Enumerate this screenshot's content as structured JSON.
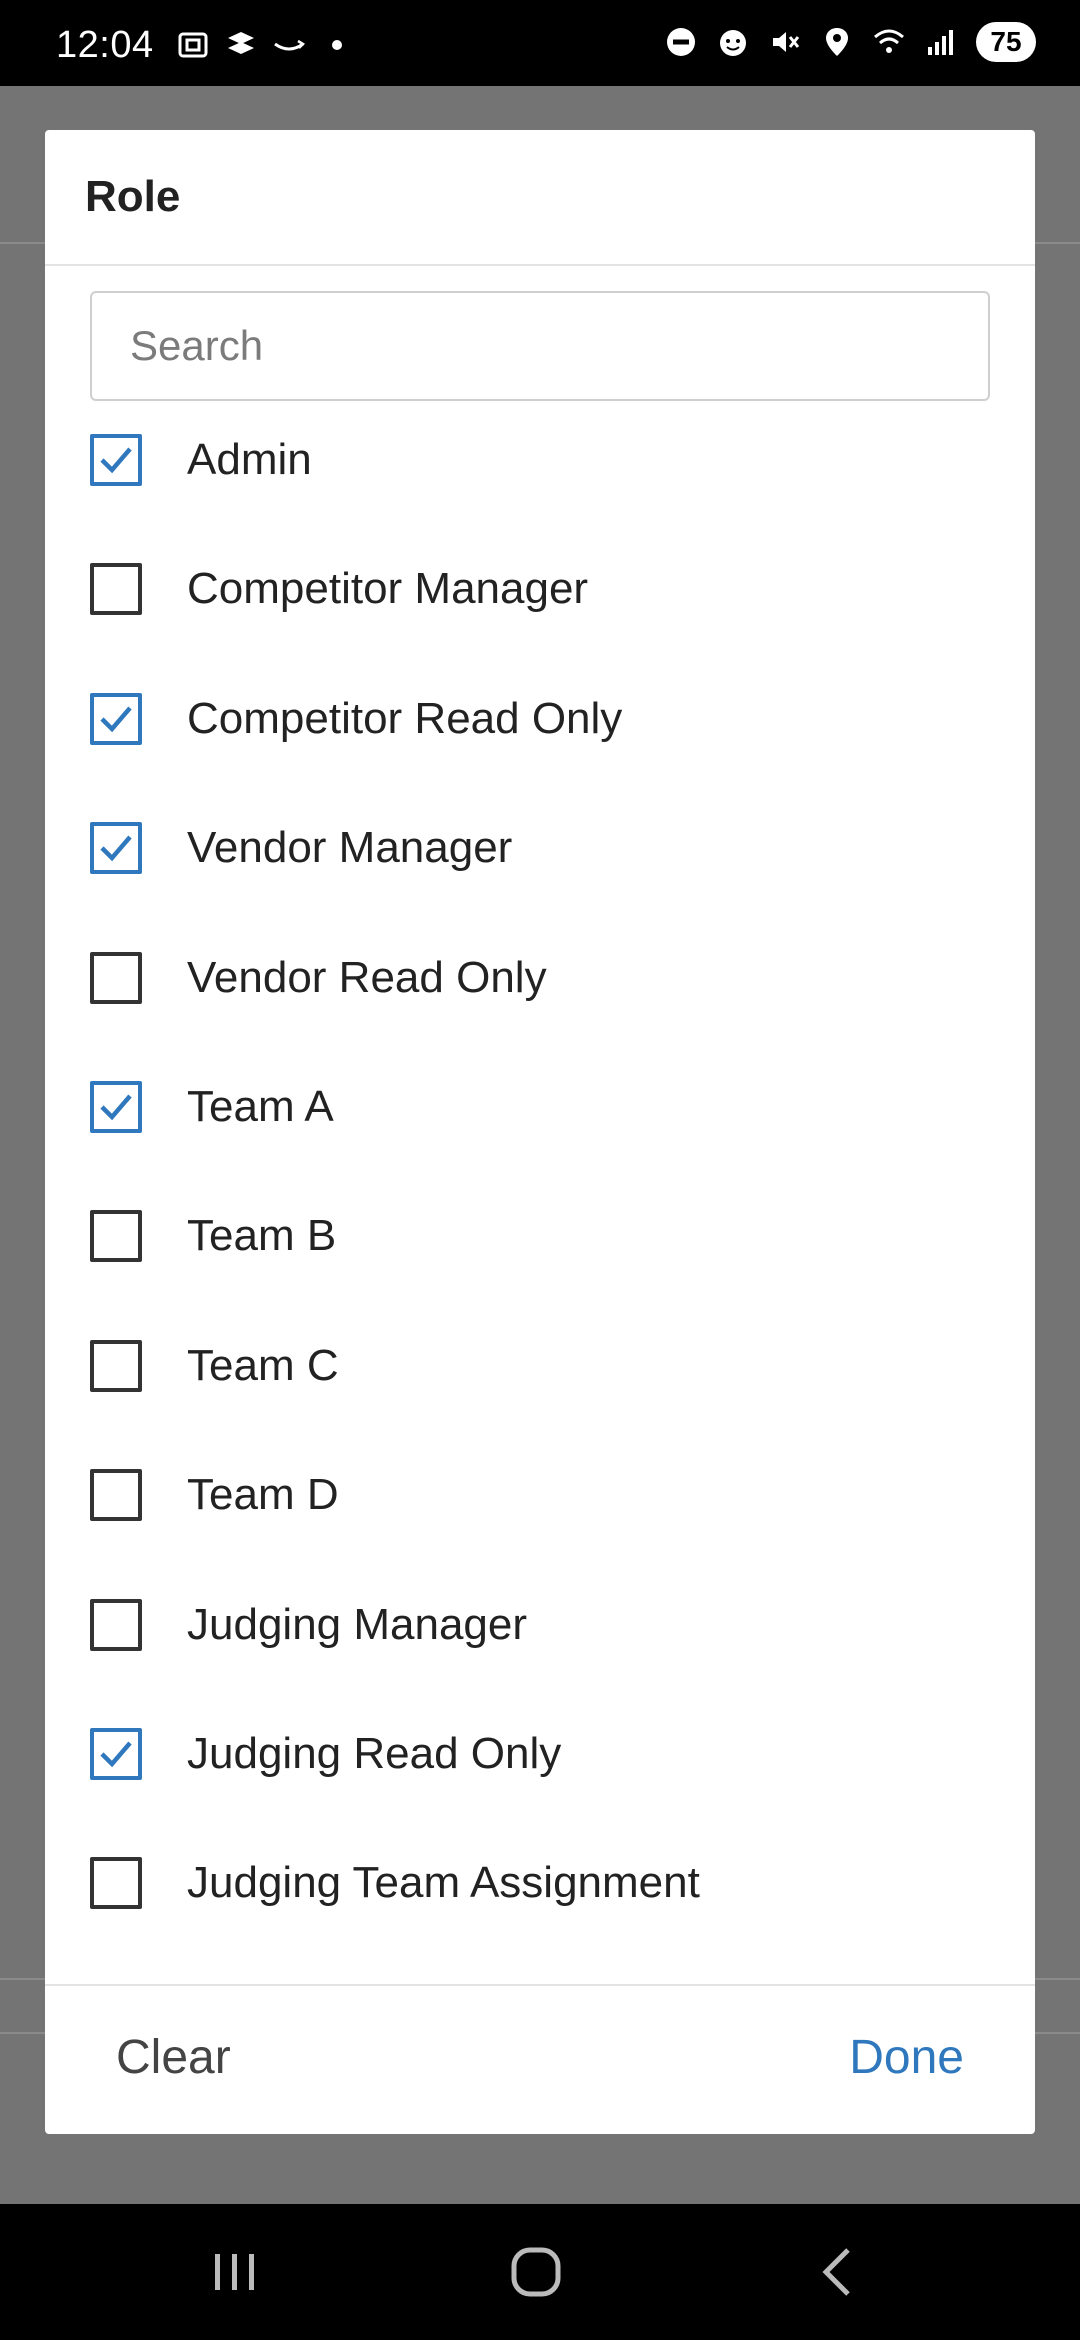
{
  "status_bar": {
    "time": "12:04",
    "battery": "75",
    "left_icons": [
      "screenshot-icon",
      "dropbox-icon",
      "amazon-icon",
      "dot-icon"
    ],
    "right_icons": [
      "dnd-icon",
      "face-icon",
      "mute-icon",
      "location-icon",
      "wifi-icon",
      "signal-icon"
    ]
  },
  "dialog": {
    "title": "Role",
    "search": {
      "placeholder": "Search",
      "value": ""
    },
    "options": [
      {
        "label": "Admin",
        "checked": true
      },
      {
        "label": "Competitor Manager",
        "checked": false
      },
      {
        "label": "Competitor Read Only",
        "checked": true
      },
      {
        "label": "Vendor Manager",
        "checked": true
      },
      {
        "label": "Vendor Read Only",
        "checked": false
      },
      {
        "label": "Team A",
        "checked": true
      },
      {
        "label": "Team B",
        "checked": false
      },
      {
        "label": "Team C",
        "checked": false
      },
      {
        "label": "Team D",
        "checked": false
      },
      {
        "label": "Judging Manager",
        "checked": false
      },
      {
        "label": "Judging Read Only",
        "checked": true
      },
      {
        "label": "Judging Team Assignment",
        "checked": false
      }
    ],
    "footer": {
      "clear_label": "Clear",
      "done_label": "Done"
    }
  },
  "colors": {
    "accent": "#2f78bd",
    "overlay": "#747474"
  },
  "nav_bar": {
    "buttons": [
      "recents-icon",
      "home-icon",
      "back-icon"
    ]
  }
}
